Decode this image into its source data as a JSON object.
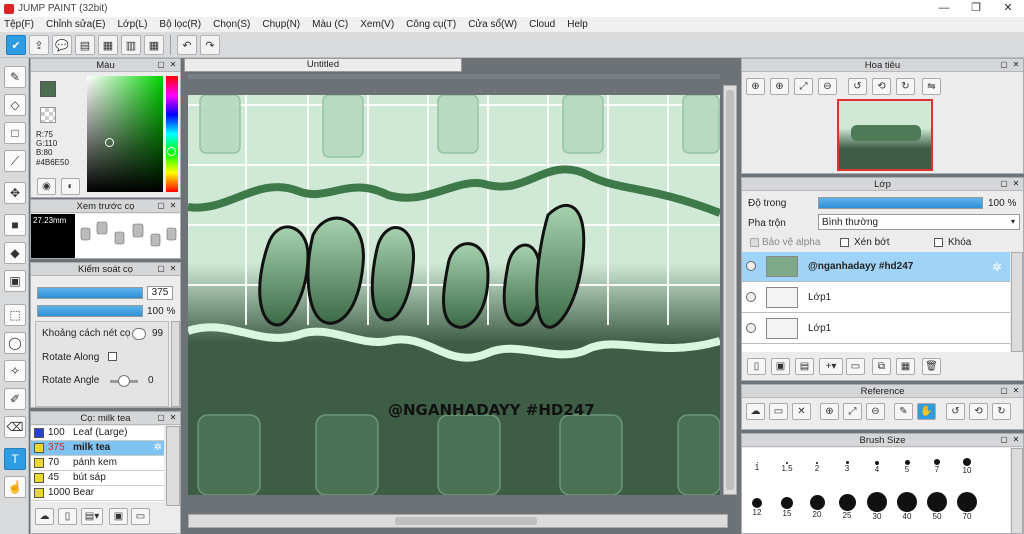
{
  "window": {
    "title": "JUMP PAINT (32bit)",
    "min": "—",
    "restore": "❐",
    "close": "✕"
  },
  "menu": [
    "Tệp(F)",
    "Chỉnh sửa(E)",
    "Lớp(L)",
    "Bộ lọc(R)",
    "Chọn(S)",
    "Chụp(N)",
    "Màu (C)",
    "Xem(V)",
    "Công cụ(T)",
    "Cửa sổ(W)",
    "Cloud",
    "Help"
  ],
  "toolbar_icons": [
    "check-icon",
    "export-icon",
    "speech-icon",
    "comment-icon",
    "document-icon",
    "panel-icon",
    "grid-icon",
    "undo-icon",
    "redo-icon"
  ],
  "color_panel": {
    "title": "Màu",
    "r": "R:75",
    "g": "G:110",
    "b": "B:80",
    "hex": "#4B6E50",
    "fg_color": "#4b6e50"
  },
  "brush_preview": {
    "title": "Xem trước cọ",
    "size": "27.23mm"
  },
  "brush_control": {
    "title": "Kiểm soát cọ",
    "size_value": "375",
    "opacity_value": "100 %",
    "spacing_label": "Khoảng cách nét cọ",
    "spacing_value": "99",
    "rotate_along": "Rotate Along",
    "rotate_angle": "Rotate Angle",
    "rotate_angle_value": "0"
  },
  "brush_presets": {
    "title": "Cọ: milk tea",
    "items": [
      {
        "num": "100",
        "name": "Leaf (Large)",
        "color": "#2a3fd8"
      },
      {
        "num": "375",
        "name": "milk tea",
        "color": "#e8d830"
      },
      {
        "num": "70",
        "name": "pánh kem",
        "color": "#e8d830"
      },
      {
        "num": "45",
        "name": "bút sáp",
        "color": "#e8d830"
      },
      {
        "num": "1000",
        "name": "Bear",
        "color": "#e8d830"
      }
    ]
  },
  "document": {
    "tab": "Untitled"
  },
  "artwork": {
    "watermark": "@NGANHADAYY #HD247",
    "accent_light": "#cfe9d6",
    "accent_dark": "#3e5d46"
  },
  "navigator": {
    "title": "Hoa tiêu"
  },
  "layers": {
    "title": "Lớp",
    "opacity_label": "Độ trong",
    "opacity_value": "100 %",
    "blend_label": "Pha trộn",
    "blend_value": "Bình thường",
    "protect_alpha": "Bảo vệ alpha",
    "clip": "Xén bớt",
    "lock": "Khóa",
    "items": [
      {
        "name": "@nganhadayy #hd247"
      },
      {
        "name": "Lớp1"
      },
      {
        "name": "Lớp1"
      }
    ]
  },
  "reference": {
    "title": "Reference"
  },
  "brush_size": {
    "title": "Brush Size",
    "row1": [
      "1",
      "1.5",
      "2",
      "3",
      "4",
      "5",
      "7",
      "10"
    ],
    "row2": [
      "12",
      "15",
      "20",
      "25",
      "30",
      "40",
      "50",
      "70"
    ]
  }
}
